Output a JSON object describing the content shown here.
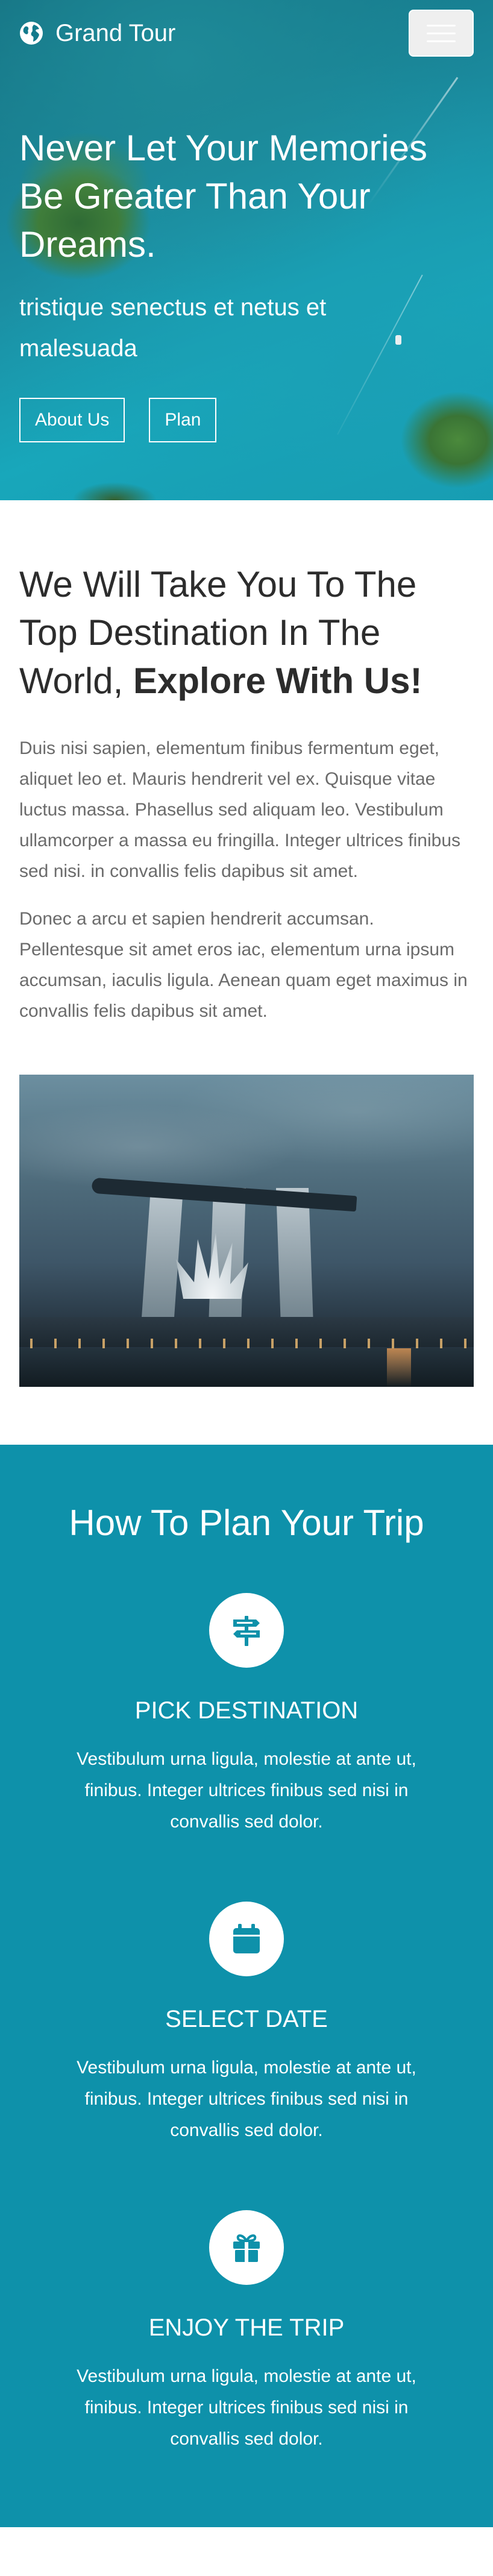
{
  "colors": {
    "accent": "#0e91aa",
    "text_dark": "#2c2c2c",
    "text_muted": "#6b6b6b",
    "white": "#ffffff"
  },
  "navbar": {
    "brand_icon": "globe-icon",
    "brand_name": "Grand Tour",
    "menu_icon": "hamburger-menu-icon"
  },
  "hero": {
    "title": "Never Let Your Memories Be Greater Than Your Dreams.",
    "subtitle": "tristique senectus et netus et malesuada",
    "buttons": {
      "about": "About Us",
      "plan": "Plan"
    }
  },
  "about": {
    "heading_prefix": "We Will Take You To The Top Destination In The World, ",
    "heading_emphasis": "Explore With Us!",
    "paragraphs": [
      "Duis nisi sapien, elementum finibus fermentum eget, aliquet leo et. Mauris hendrerit vel ex. Quisque vitae luctus massa. Phasellus sed aliquam leo. Vestibulum ullamcorper a massa eu fringilla. Integer ultrices finibus sed nisi. in convallis felis dapibus sit amet.",
      "Donec a arcu et sapien hendrerit accumsan. Pellentesque sit amet eros iac, elementum urna ipsum accumsan, iaculis ligula. Aenean quam eget maximus in convallis felis dapibus sit amet."
    ]
  },
  "plan": {
    "title": "How To Plan Your Trip",
    "steps": [
      {
        "icon": "signpost-icon",
        "title": "Pick Destination",
        "text": "Vestibulum urna ligula, molestie at ante ut, finibus. Integer ultrices finibus sed nisi in convallis sed dolor."
      },
      {
        "icon": "calendar-icon",
        "title": "Select Date",
        "text": "Vestibulum urna ligula, molestie at ante ut, finibus. Integer ultrices finibus sed nisi in convallis sed dolor."
      },
      {
        "icon": "gift-icon",
        "title": "Enjoy The Trip",
        "text": "Vestibulum urna ligula, molestie at ante ut, finibus. Integer ultrices finibus sed nisi in convallis sed dolor."
      }
    ]
  }
}
